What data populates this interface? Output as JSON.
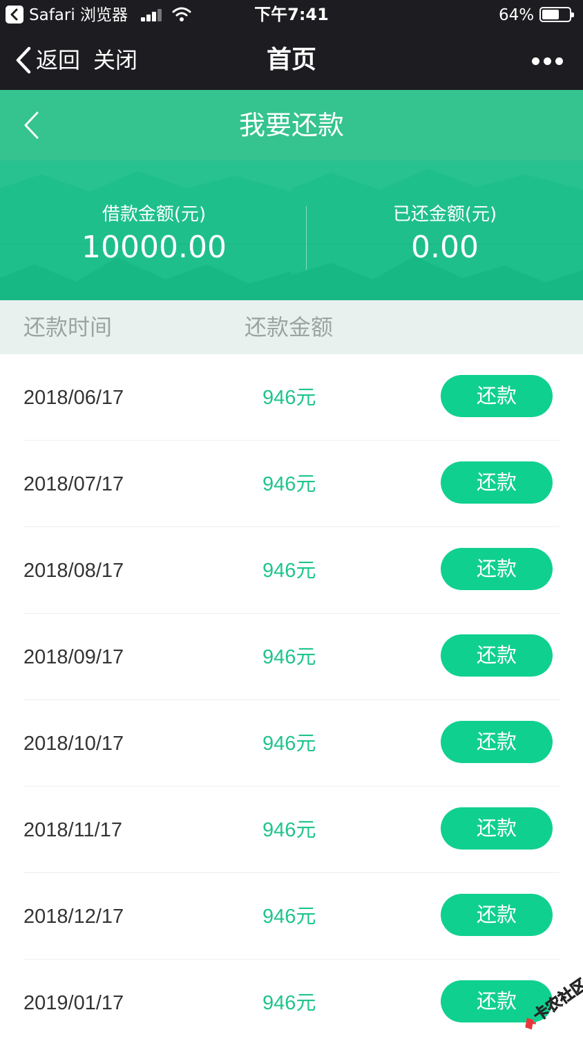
{
  "status_bar": {
    "app": "Safari 浏览器",
    "time": "下午7:41",
    "battery": "64%",
    "battery_level": 0.64
  },
  "nav": {
    "back_label": "返回",
    "close_label": "关闭",
    "title": "首页",
    "more_icon": "more-dots-icon"
  },
  "page": {
    "title": "我要还款",
    "back_icon": "chevron-left-icon"
  },
  "summary": {
    "loan_label": "借款金额(元)",
    "loan_value": "10000.00",
    "repaid_label": "已还金额(元)",
    "repaid_value": "0.00"
  },
  "table": {
    "header_date": "还款时间",
    "header_amount": "还款金额",
    "rows": [
      {
        "date": "2018/06/17",
        "amount": "946元",
        "action": "还款"
      },
      {
        "date": "2018/07/17",
        "amount": "946元",
        "action": "还款"
      },
      {
        "date": "2018/08/17",
        "amount": "946元",
        "action": "还款"
      },
      {
        "date": "2018/09/17",
        "amount": "946元",
        "action": "还款"
      },
      {
        "date": "2018/10/17",
        "amount": "946元",
        "action": "还款"
      },
      {
        "date": "2018/11/17",
        "amount": "946元",
        "action": "还款"
      },
      {
        "date": "2018/12/17",
        "amount": "946元",
        "action": "还款"
      },
      {
        "date": "2019/01/17",
        "amount": "946元",
        "action": "还款"
      }
    ]
  },
  "watermark": {
    "text": "卡农社区"
  },
  "colors": {
    "dark_bar": "#1d1d21",
    "header_green": "#35c38f",
    "banner_green": "#1fbf8c",
    "amount_green": "#1fc48e",
    "button_green": "#10d08f",
    "column_header_bg": "#e8f1ee"
  }
}
